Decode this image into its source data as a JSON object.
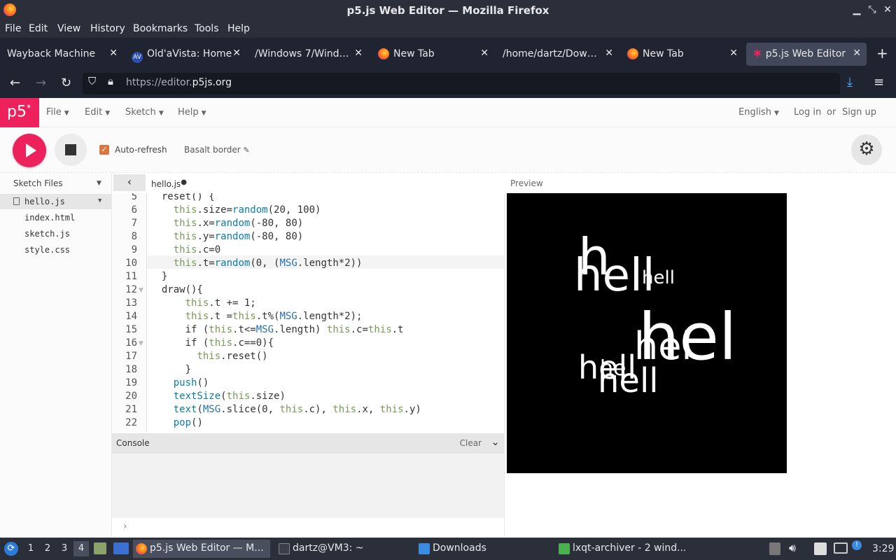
{
  "window": {
    "title": "p5.js Web Editor — Mozilla Firefox"
  },
  "menubar": [
    "File",
    "Edit",
    "View",
    "History",
    "Bookmarks",
    "Tools",
    "Help"
  ],
  "tabs": [
    {
      "label": "Wayback Machine"
    },
    {
      "label": "Old'aVista: Home"
    },
    {
      "label": "/Windows 7/Windows"
    },
    {
      "label": "New Tab"
    },
    {
      "label": "/home/dartz/Downloads"
    },
    {
      "label": "New Tab"
    },
    {
      "label": "p5.js Web Editor"
    }
  ],
  "address": {
    "prefix": "https://editor.",
    "domain": "p5js.org"
  },
  "app": {
    "logo": "p5",
    "logo_sup": "*",
    "menu": [
      "File",
      "Edit",
      "Sketch",
      "Help"
    ],
    "language": "English",
    "login": "Log in",
    "or": "or",
    "signup": "Sign up",
    "auto_refresh": "Auto-refresh",
    "sketch_name": "Basalt border",
    "sketch_files_label": "Sketch Files",
    "files": [
      "hello.js",
      "index.html",
      "sketch.js",
      "style.css"
    ],
    "open_file": "hello.js",
    "preview_label": "Preview",
    "console_label": "Console",
    "console_clear": "Clear"
  },
  "code_lines": [
    {
      "n": "5",
      "text": "  reset() {"
    },
    {
      "n": "6",
      "text": "    this.size=random(20, 100)"
    },
    {
      "n": "7",
      "text": "    this.x=random(-80, 80)"
    },
    {
      "n": "8",
      "text": "    this.y=random(-80, 80)"
    },
    {
      "n": "9",
      "text": "    this.c=0"
    },
    {
      "n": "10",
      "text": "    this.t=random(0, (MSG.length*2))"
    },
    {
      "n": "11",
      "text": "  }"
    },
    {
      "n": "12",
      "text": "  draw(){"
    },
    {
      "n": "13",
      "text": "      this.t += 1;"
    },
    {
      "n": "14",
      "text": "      this.t =this.t%(MSG.length*2);"
    },
    {
      "n": "15",
      "text": "      if (this.t<=MSG.length) this.c=this.t"
    },
    {
      "n": "16",
      "text": "      if (this.c==0){"
    },
    {
      "n": "17",
      "text": "        this.reset()"
    },
    {
      "n": "18",
      "text": "      }"
    },
    {
      "n": "19",
      "text": "    push()"
    },
    {
      "n": "20",
      "text": "    textSize(this.size)"
    },
    {
      "n": "21",
      "text": "    text(MSG.slice(0, this.c), this.x, this.y)"
    },
    {
      "n": "22",
      "text": "    pop()"
    }
  ],
  "preview_words": [
    "h",
    "hell",
    "hell",
    "hel",
    "hel",
    "hell",
    "he",
    "hell"
  ],
  "taskbar": {
    "workspaces": [
      "1",
      "2",
      "3",
      "4"
    ],
    "tasks": [
      "p5.js Web Editor — M...",
      "dartz@VM3: ~",
      "Downloads",
      "lxqt-archiver - 2 wind..."
    ],
    "clock": "3:29"
  },
  "colors": {
    "p5_pink": "#ed225d",
    "titlebar": "#2a2f3a",
    "tabbar": "#1f2430"
  }
}
